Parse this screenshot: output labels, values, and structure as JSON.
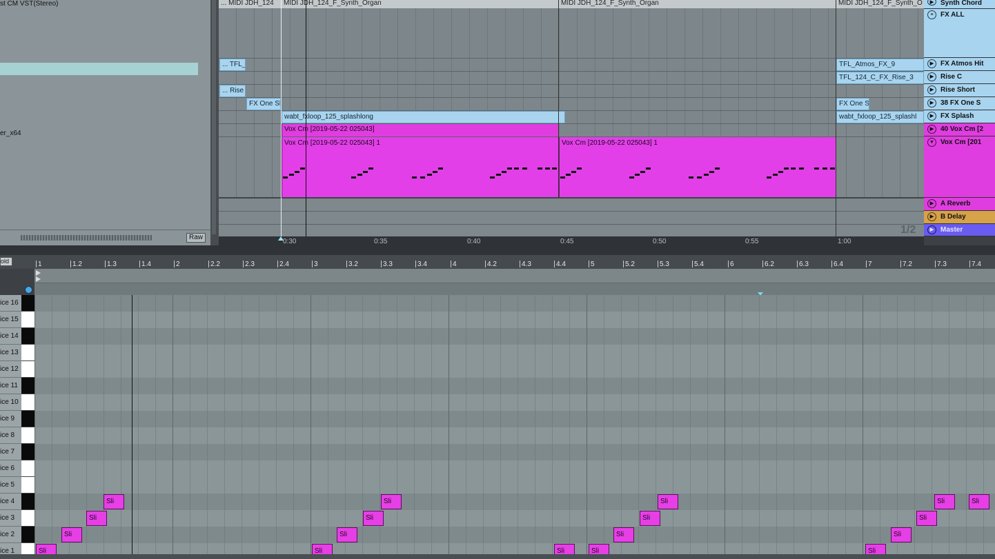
{
  "browser": {
    "device_title": "st CM VST(Stereo)",
    "device2": "er_x64",
    "raw_button": "Raw"
  },
  "arrangement": {
    "top_clips": [
      {
        "label": "... MIDI JDH_124"
      },
      {
        "label": "MIDI JDH_124_F_Synth_Organ"
      },
      {
        "label": "MIDI JDH_124_F_Synth_Organ"
      },
      {
        "label": "MIDI JDH_124_F_Synth_O"
      }
    ],
    "clips": {
      "tfl_left": "... TFL_",
      "rise_left": "... Rise S",
      "fxoneshot_left": "FX One Sh",
      "splash": "wabt_fxloop_125_splashlong",
      "vox_small": "Vox Cm [2019-05-22 025043]",
      "vox_big1": "Vox Cm [2019-05-22 025043] 1",
      "vox_big2": "Vox Cm [2019-05-22 025043] 1",
      "tfl_right": "TFL_Atmos_FX_9",
      "rise_right": "TFL_124_C_FX_Rise_3",
      "fxoneshot_right": "FX One Sh",
      "splash_right": "wabt_fxloop_125_splashl"
    },
    "tracks": [
      {
        "name": "Synth Chord"
      },
      {
        "name": "FX ALL"
      },
      {
        "name": "FX Atmos Hit"
      },
      {
        "name": "Rise C"
      },
      {
        "name": "Rise Short"
      },
      {
        "name": "38 FX One S"
      },
      {
        "name": "FX Splash"
      },
      {
        "name": "40 Vox Cm [2"
      },
      {
        "name": "Vox Cm [201"
      },
      {
        "name": "A Reverb"
      },
      {
        "name": "B Delay"
      },
      {
        "name": "Master"
      }
    ],
    "page_indicator": "1/2",
    "time_labels": [
      "0:30",
      "0:35",
      "0:40",
      "0:45",
      "0:50",
      "0:55",
      "1:00"
    ]
  },
  "piano_roll": {
    "fold_button": "old",
    "beat_labels": [
      "1",
      "1.2",
      "1.3",
      "1.4",
      "2",
      "2.2",
      "2.3",
      "2.4",
      "3",
      "3.2",
      "3.3",
      "3.4",
      "4",
      "4.2",
      "4.3",
      "4.4",
      "5",
      "5.2",
      "5.3",
      "5.4",
      "6",
      "6.2",
      "6.3",
      "6.4",
      "7",
      "7.2",
      "7.3",
      "7.4"
    ],
    "keys": [
      "ice 16",
      "ice 15",
      "ice 14",
      "ice 13",
      "ice 12",
      "ice 11",
      "ice 10",
      "ice 9",
      "ice 8",
      "ice 7",
      "ice 6",
      "ice 5",
      "ice 4",
      "ice 3",
      "ice 2",
      "ice 1"
    ],
    "note_label": "Sli"
  },
  "colors": {
    "clip_pink": "#e03de0",
    "clip_blue": "#a8d4ef",
    "accent_orange": "#d6a24a",
    "master_purple": "#6a5cf0"
  }
}
